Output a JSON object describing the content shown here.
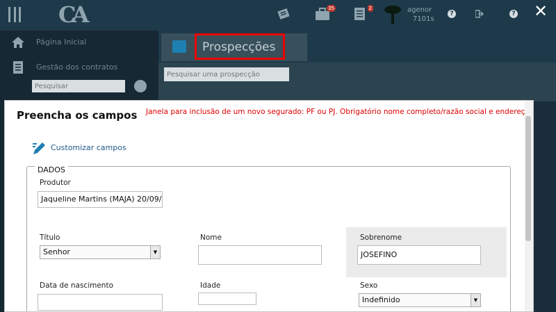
{
  "topbar": {
    "notif_badge_1": "35",
    "notif_badge_2": "2",
    "user_name": "agenor",
    "user_code": "7101s",
    "help_glyph": "?",
    "close_glyph": "✕"
  },
  "sidebar": {
    "items": [
      {
        "label": "Página Inicial",
        "icon": "home-icon"
      },
      {
        "label": "Gestão dos contratos",
        "icon": "contracts-icon"
      }
    ],
    "search_placeholder": "Pesquisar"
  },
  "main": {
    "tab_title": "Prospecções",
    "search_placeholder": "Pesquisar uma prospecção"
  },
  "modal": {
    "title": "Preencha os campos",
    "note": "Janela para inclusão de um novo segurado: PF ou PJ. Obrigatório nome completo/razão social e endereço.",
    "customize_label": "Customizar campos",
    "section_legend": "DADOS",
    "fields": {
      "produtor": {
        "label": "Produtor",
        "value": "Jaqueline Martins (MAJA) 20/09/"
      },
      "titulo": {
        "label": "Título",
        "value": "Senhor"
      },
      "nome": {
        "label": "Nome",
        "value": ""
      },
      "sobrenome": {
        "label": "Sobrenome",
        "value": "JOSEFINO"
      },
      "nascimento": {
        "label": "Data de nascimento",
        "value": ""
      },
      "idade": {
        "label": "Idade",
        "value": ""
      },
      "sexo": {
        "label": "Sexo",
        "value": "Indefinido"
      }
    }
  },
  "colors": {
    "topbar": "#1e3a4a",
    "sidebar": "#162834",
    "highlight_border": "#ee0000",
    "note_text": "#e00000",
    "link": "#1e5a8a"
  }
}
